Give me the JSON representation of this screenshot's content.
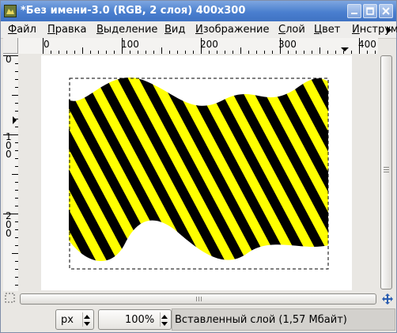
{
  "window": {
    "title": "*Без имени-3.0 (RGB, 2 слоя) 400x300",
    "icon": "gimp-icon",
    "buttons": [
      "minimize-icon",
      "maximize-icon",
      "close-icon"
    ]
  },
  "menu": {
    "items": [
      {
        "u": "Ф",
        "rest": "айл"
      },
      {
        "u": "П",
        "rest": "равка"
      },
      {
        "u": "В",
        "rest": "ыделение"
      },
      {
        "u": "В",
        "rest": "ид"
      },
      {
        "u": "И",
        "rest": "зображение"
      },
      {
        "u": "С",
        "rest": "лой"
      },
      {
        "u": "Ц",
        "rest": "вет"
      },
      {
        "u": "И",
        "rest": "нструм"
      }
    ]
  },
  "rulers": {
    "horizontal": [
      "0",
      "100",
      "200",
      "300",
      "400"
    ],
    "vertical": [
      "0",
      "100",
      "200"
    ]
  },
  "canvas": {
    "stripe_colors": [
      "#ffff00",
      "#000000"
    ],
    "background": "#ffffff"
  },
  "status": {
    "unit": "px",
    "zoom": "100%",
    "message": "Вставленный слой (1,57 Мбайт)"
  }
}
